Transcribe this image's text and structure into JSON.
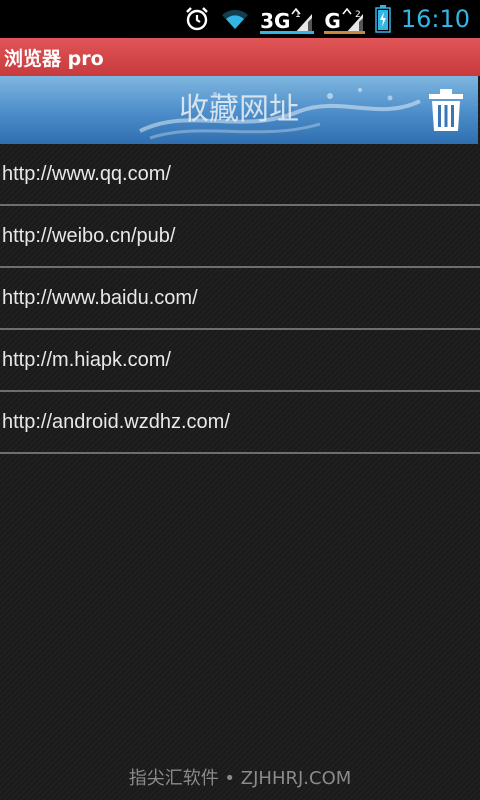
{
  "status_bar": {
    "network_1": {
      "label": "3G",
      "underline_color": "#33b5e5"
    },
    "network_2": {
      "label": "G",
      "underline_color": "#c88a3a"
    },
    "sim_1_label": "1",
    "sim_2_label": "2",
    "time": "16:10",
    "icons": [
      "alarm-icon",
      "wifi-icon",
      "signal-icon",
      "battery-icon"
    ]
  },
  "app": {
    "title": "浏览器 pro",
    "title_bar_color": "#d44a4c"
  },
  "banner": {
    "title": "收藏网址",
    "delete_icon": "trash-icon"
  },
  "bookmarks": [
    "http://www.qq.com/",
    "http://weibo.cn/pub/",
    "http://www.baidu.com/",
    "http://m.hiapk.com/",
    "http://android.wzdhz.com/"
  ],
  "watermark": "指尖汇软件 • ZJHHRJ.COM"
}
